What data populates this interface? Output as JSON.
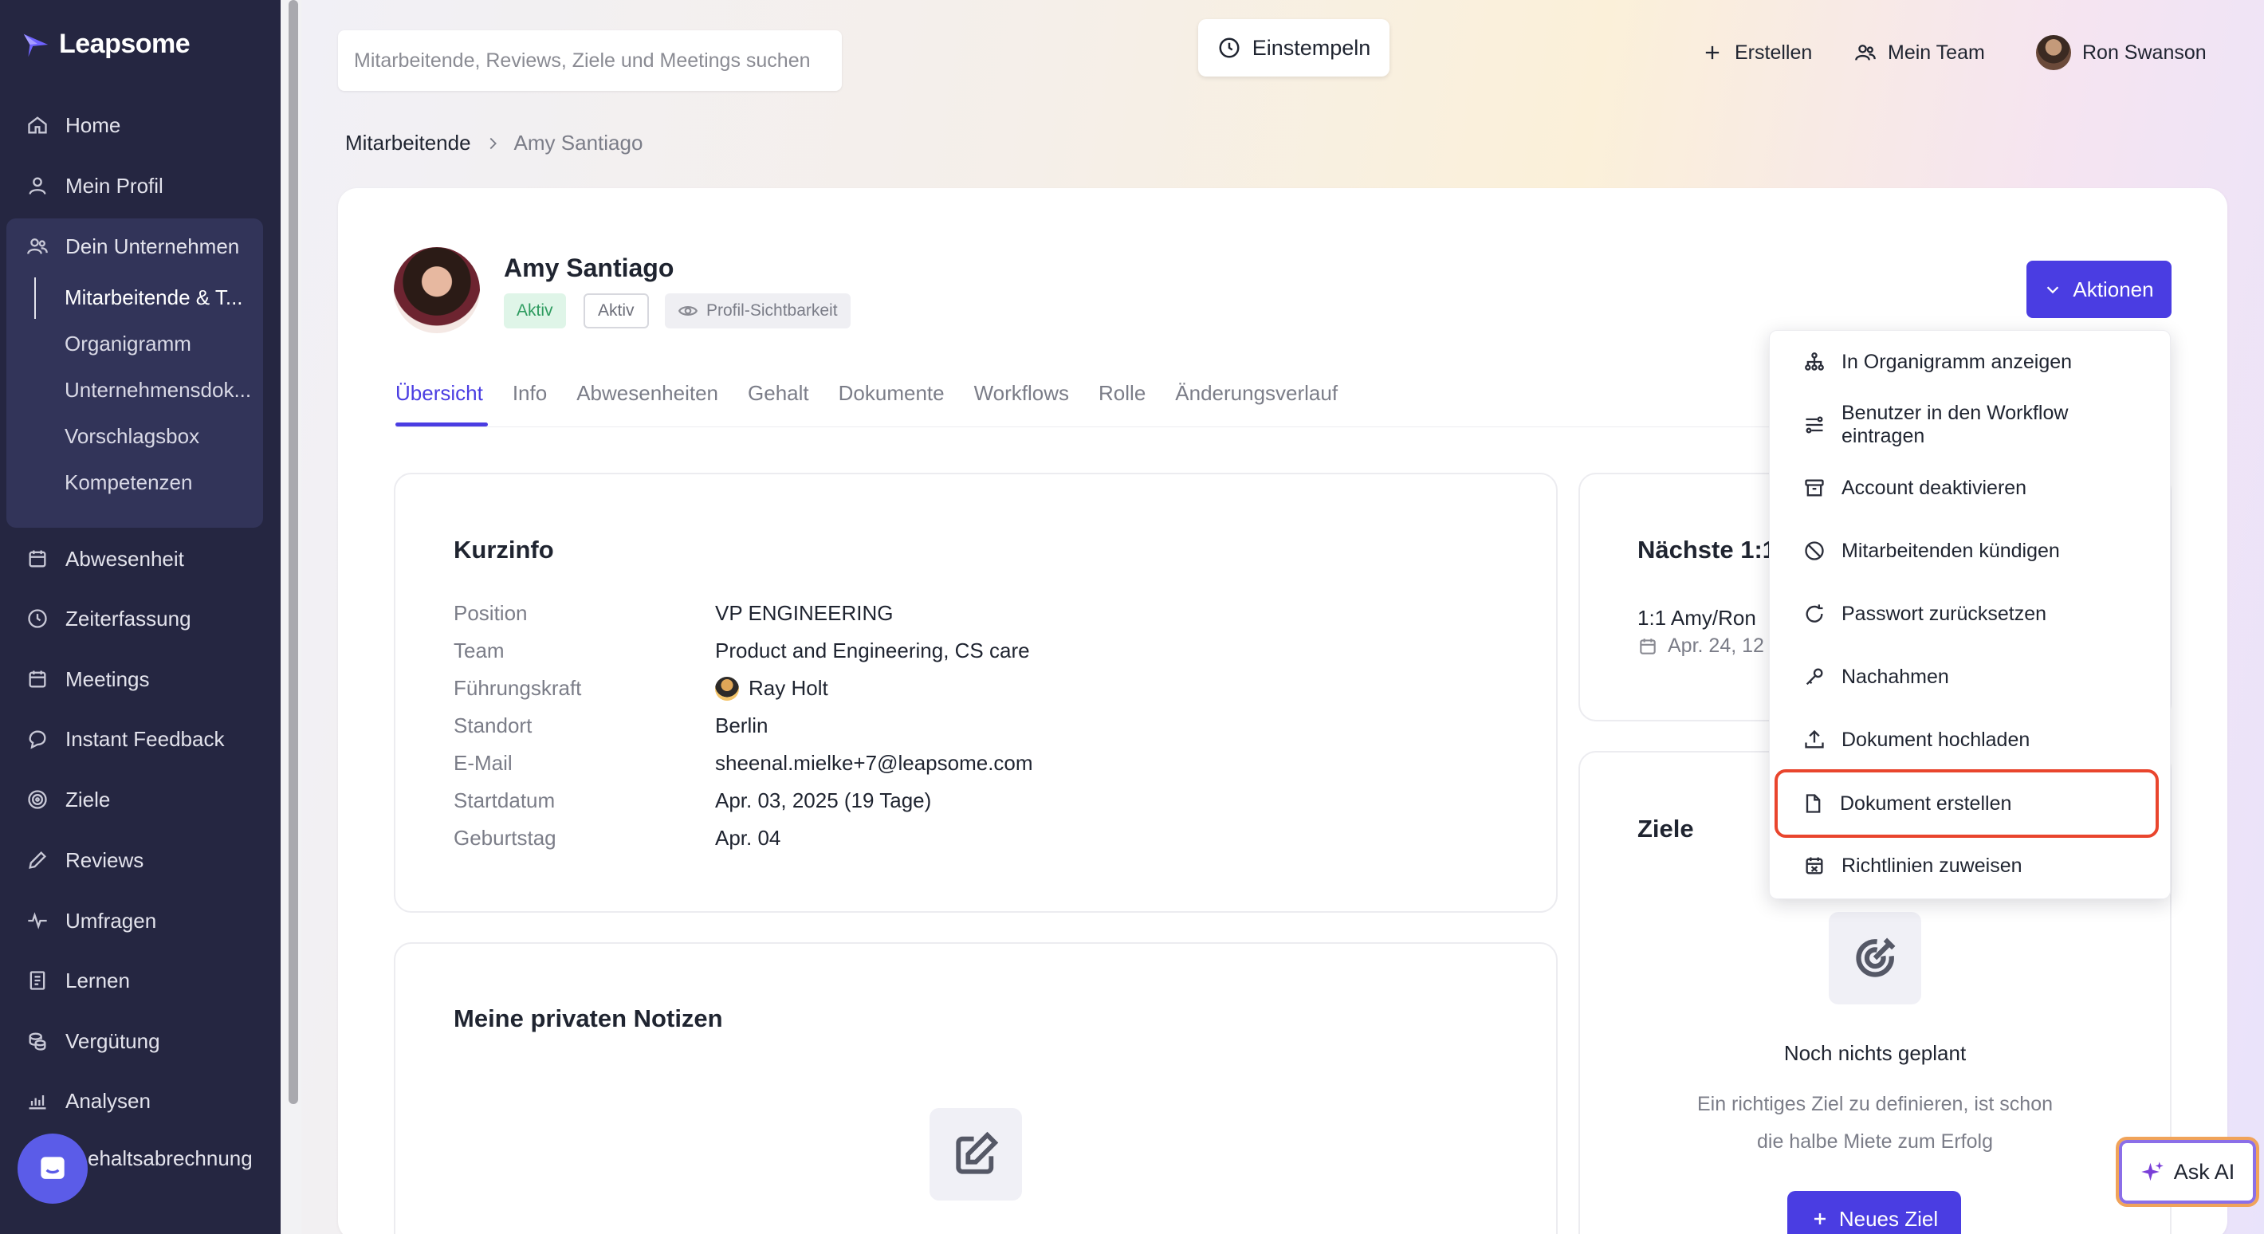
{
  "app": {
    "name": "Leapsome"
  },
  "sidebar": {
    "items": [
      {
        "label": "Home",
        "icon": "home-icon"
      },
      {
        "label": "Mein Profil",
        "icon": "user-icon"
      },
      {
        "label": "Dein Unternehmen",
        "icon": "users-icon"
      },
      {
        "label": "Abwesenheit",
        "icon": "calendar-icon"
      },
      {
        "label": "Zeiterfassung",
        "icon": "clock-icon"
      },
      {
        "label": "Meetings",
        "icon": "calendar-icon"
      },
      {
        "label": "Instant Feedback",
        "icon": "chat-icon"
      },
      {
        "label": "Ziele",
        "icon": "target-icon"
      },
      {
        "label": "Reviews",
        "icon": "pen-icon"
      },
      {
        "label": "Umfragen",
        "icon": "pulse-icon"
      },
      {
        "label": "Lernen",
        "icon": "book-icon"
      },
      {
        "label": "Vergütung",
        "icon": "coins-icon"
      },
      {
        "label": "Analysen",
        "icon": "chart-icon"
      },
      {
        "label": "ehaltsabrechnung",
        "icon": "money-icon"
      }
    ],
    "subitems": [
      "Mitarbeitende & T...",
      "Organigramm",
      "Unternehmensdok...",
      "Vorschlagsbox",
      "Kompetenzen"
    ]
  },
  "topbar": {
    "search_placeholder": "Mitarbeitende, Reviews, Ziele und Meetings suchen",
    "clockin_label": "Einstempeln",
    "create_label": "Erstellen",
    "team_label": "Mein Team",
    "user_name": "Ron Swanson"
  },
  "breadcrumb": {
    "parent": "Mitarbeitende",
    "current": "Amy Santiago"
  },
  "profile": {
    "name": "Amy Santiago",
    "badge_status": "Aktiv",
    "badge_state": "Aktiv",
    "visibility_label": "Profil-Sichtbarkeit",
    "actions_label": "Aktionen"
  },
  "tabs": [
    "Übersicht",
    "Info",
    "Abwesenheiten",
    "Gehalt",
    "Dokumente",
    "Workflows",
    "Rolle",
    "Änderungsverlauf"
  ],
  "kurzinfo": {
    "title": "Kurzinfo",
    "rows": [
      {
        "key": "Position",
        "value": "VP ENGINEERING"
      },
      {
        "key": "Team",
        "value": "Product and Engineering, CS care"
      },
      {
        "key": "Führungskraft",
        "value": "Ray Holt"
      },
      {
        "key": "Standort",
        "value": "Berlin"
      },
      {
        "key": "E-Mail",
        "value": "sheenal.mielke+7@leapsome.com"
      },
      {
        "key": "Startdatum",
        "value": "Apr. 03, 2025 (19 Tage)"
      },
      {
        "key": "Geburtstag",
        "value": "Apr. 04"
      }
    ]
  },
  "notes": {
    "title": "Meine privaten Notizen"
  },
  "next_meeting": {
    "title": "Nächste 1:1",
    "meeting_name": "1:1 Amy/Ron",
    "meeting_date": "Apr. 24, 12"
  },
  "goals": {
    "title": "Ziele",
    "empty_title": "Noch nichts geplant",
    "empty_desc_1": "Ein richtiges Ziel zu definieren, ist schon",
    "empty_desc_2": "die halbe Miete zum Erfolg",
    "new_goal_label": "Neues Ziel"
  },
  "dropdown": {
    "items": [
      "In Organigramm anzeigen",
      "Benutzer in den Workflow eintragen",
      "Account deaktivieren",
      "Mitarbeitenden kündigen",
      "Passwort zurücksetzen",
      "Nachahmen",
      "Dokument hochladen",
      "Dokument erstellen",
      "Richtlinien zuweisen"
    ]
  },
  "ask_ai": {
    "label": "Ask AI"
  },
  "colors": {
    "accent": "#4a3de2",
    "sidebar": "#252641",
    "highlight": "#e9452d",
    "success": "#2d9b5f"
  }
}
